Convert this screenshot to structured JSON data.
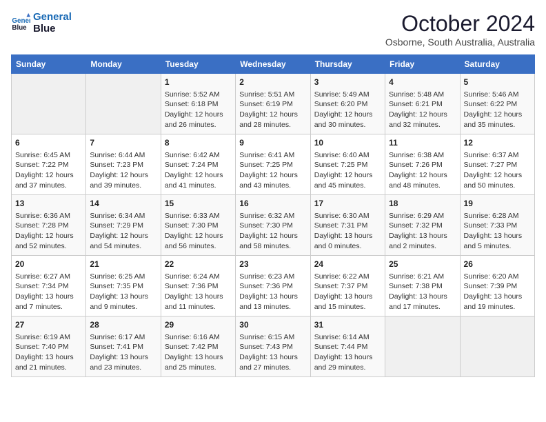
{
  "header": {
    "logo_line1": "General",
    "logo_line2": "Blue",
    "month_title": "October 2024",
    "location": "Osborne, South Australia, Australia"
  },
  "days_of_week": [
    "Sunday",
    "Monday",
    "Tuesday",
    "Wednesday",
    "Thursday",
    "Friday",
    "Saturday"
  ],
  "weeks": [
    [
      {
        "day": "",
        "info": ""
      },
      {
        "day": "",
        "info": ""
      },
      {
        "day": "1",
        "info": "Sunrise: 5:52 AM\nSunset: 6:18 PM\nDaylight: 12 hours\nand 26 minutes."
      },
      {
        "day": "2",
        "info": "Sunrise: 5:51 AM\nSunset: 6:19 PM\nDaylight: 12 hours\nand 28 minutes."
      },
      {
        "day": "3",
        "info": "Sunrise: 5:49 AM\nSunset: 6:20 PM\nDaylight: 12 hours\nand 30 minutes."
      },
      {
        "day": "4",
        "info": "Sunrise: 5:48 AM\nSunset: 6:21 PM\nDaylight: 12 hours\nand 32 minutes."
      },
      {
        "day": "5",
        "info": "Sunrise: 5:46 AM\nSunset: 6:22 PM\nDaylight: 12 hours\nand 35 minutes."
      }
    ],
    [
      {
        "day": "6",
        "info": "Sunrise: 6:45 AM\nSunset: 7:22 PM\nDaylight: 12 hours\nand 37 minutes."
      },
      {
        "day": "7",
        "info": "Sunrise: 6:44 AM\nSunset: 7:23 PM\nDaylight: 12 hours\nand 39 minutes."
      },
      {
        "day": "8",
        "info": "Sunrise: 6:42 AM\nSunset: 7:24 PM\nDaylight: 12 hours\nand 41 minutes."
      },
      {
        "day": "9",
        "info": "Sunrise: 6:41 AM\nSunset: 7:25 PM\nDaylight: 12 hours\nand 43 minutes."
      },
      {
        "day": "10",
        "info": "Sunrise: 6:40 AM\nSunset: 7:25 PM\nDaylight: 12 hours\nand 45 minutes."
      },
      {
        "day": "11",
        "info": "Sunrise: 6:38 AM\nSunset: 7:26 PM\nDaylight: 12 hours\nand 48 minutes."
      },
      {
        "day": "12",
        "info": "Sunrise: 6:37 AM\nSunset: 7:27 PM\nDaylight: 12 hours\nand 50 minutes."
      }
    ],
    [
      {
        "day": "13",
        "info": "Sunrise: 6:36 AM\nSunset: 7:28 PM\nDaylight: 12 hours\nand 52 minutes."
      },
      {
        "day": "14",
        "info": "Sunrise: 6:34 AM\nSunset: 7:29 PM\nDaylight: 12 hours\nand 54 minutes."
      },
      {
        "day": "15",
        "info": "Sunrise: 6:33 AM\nSunset: 7:30 PM\nDaylight: 12 hours\nand 56 minutes."
      },
      {
        "day": "16",
        "info": "Sunrise: 6:32 AM\nSunset: 7:30 PM\nDaylight: 12 hours\nand 58 minutes."
      },
      {
        "day": "17",
        "info": "Sunrise: 6:30 AM\nSunset: 7:31 PM\nDaylight: 13 hours\nand 0 minutes."
      },
      {
        "day": "18",
        "info": "Sunrise: 6:29 AM\nSunset: 7:32 PM\nDaylight: 13 hours\nand 2 minutes."
      },
      {
        "day": "19",
        "info": "Sunrise: 6:28 AM\nSunset: 7:33 PM\nDaylight: 13 hours\nand 5 minutes."
      }
    ],
    [
      {
        "day": "20",
        "info": "Sunrise: 6:27 AM\nSunset: 7:34 PM\nDaylight: 13 hours\nand 7 minutes."
      },
      {
        "day": "21",
        "info": "Sunrise: 6:25 AM\nSunset: 7:35 PM\nDaylight: 13 hours\nand 9 minutes."
      },
      {
        "day": "22",
        "info": "Sunrise: 6:24 AM\nSunset: 7:36 PM\nDaylight: 13 hours\nand 11 minutes."
      },
      {
        "day": "23",
        "info": "Sunrise: 6:23 AM\nSunset: 7:36 PM\nDaylight: 13 hours\nand 13 minutes."
      },
      {
        "day": "24",
        "info": "Sunrise: 6:22 AM\nSunset: 7:37 PM\nDaylight: 13 hours\nand 15 minutes."
      },
      {
        "day": "25",
        "info": "Sunrise: 6:21 AM\nSunset: 7:38 PM\nDaylight: 13 hours\nand 17 minutes."
      },
      {
        "day": "26",
        "info": "Sunrise: 6:20 AM\nSunset: 7:39 PM\nDaylight: 13 hours\nand 19 minutes."
      }
    ],
    [
      {
        "day": "27",
        "info": "Sunrise: 6:19 AM\nSunset: 7:40 PM\nDaylight: 13 hours\nand 21 minutes."
      },
      {
        "day": "28",
        "info": "Sunrise: 6:17 AM\nSunset: 7:41 PM\nDaylight: 13 hours\nand 23 minutes."
      },
      {
        "day": "29",
        "info": "Sunrise: 6:16 AM\nSunset: 7:42 PM\nDaylight: 13 hours\nand 25 minutes."
      },
      {
        "day": "30",
        "info": "Sunrise: 6:15 AM\nSunset: 7:43 PM\nDaylight: 13 hours\nand 27 minutes."
      },
      {
        "day": "31",
        "info": "Sunrise: 6:14 AM\nSunset: 7:44 PM\nDaylight: 13 hours\nand 29 minutes."
      },
      {
        "day": "",
        "info": ""
      },
      {
        "day": "",
        "info": ""
      }
    ]
  ]
}
